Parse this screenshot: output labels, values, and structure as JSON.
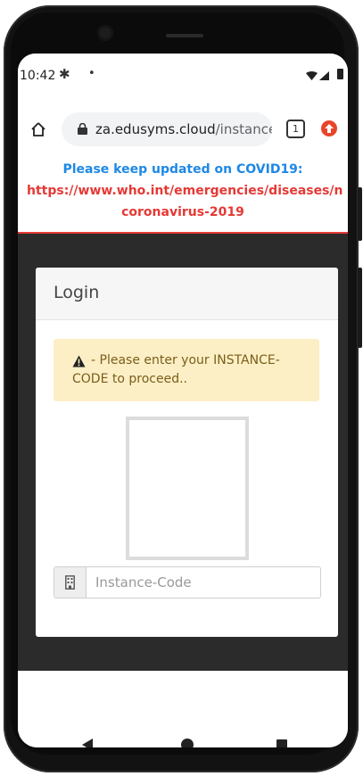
{
  "status_bar": {
    "time": "10:42",
    "settings_icon": "gear-icon",
    "notification_dot": "•",
    "icons": [
      "wifi-icon",
      "signal-icon",
      "battery-icon"
    ]
  },
  "browser": {
    "url_domain": "za.edusyms.cloud",
    "url_path": "/instance",
    "tab_count": "1",
    "icons": [
      "home-icon",
      "lock-icon",
      "extension-icon"
    ]
  },
  "banner": {
    "line1": "Please keep updated on COVID19:",
    "line2": "https://www.who.int/emergencies/diseases/n",
    "line3": "coronavirus-2019",
    "colors": {
      "primary": "#1e88e5",
      "alert": "#e53935"
    }
  },
  "login": {
    "title": "Login",
    "alert_text": "- Please enter your INSTANCE-CODE to proceed..",
    "alert_icon": "warning-icon",
    "input_placeholder": "Instance-Code",
    "input_value": "",
    "input_icon": "building-icon"
  },
  "nav": {
    "icons": [
      "back-icon",
      "home-icon",
      "recents-icon"
    ]
  }
}
